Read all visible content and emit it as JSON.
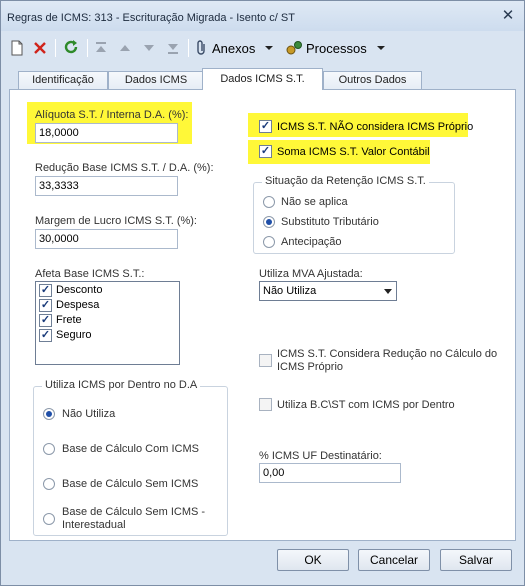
{
  "window": {
    "title": "Regras de ICMS: 313 - Escrituração Migrada - Isento c/ ST",
    "close_glyph": "✕"
  },
  "toolbar": {
    "anexos_label": "Anexos",
    "processos_label": "Processos"
  },
  "tabs": [
    {
      "label": "Identificação"
    },
    {
      "label": "Dados ICMS"
    },
    {
      "label": "Dados ICMS S.T."
    },
    {
      "label": "Outros Dados"
    }
  ],
  "form": {
    "aliquota": {
      "label": "Alíquota S.T. / Interna D.A. (%):",
      "value": "18,0000"
    },
    "reducao": {
      "label": "Redução Base ICMS S.T. / D.A. (%):",
      "value": "33,3333"
    },
    "margem": {
      "label": "Margem de Lucro ICMS S.T. (%):",
      "value": "30,0000"
    },
    "afeta_base": {
      "label": "Afeta Base ICMS S.T.:",
      "items": [
        {
          "label": "Desconto",
          "checked": true
        },
        {
          "label": "Despesa",
          "checked": true
        },
        {
          "label": "Frete",
          "checked": true
        },
        {
          "label": "Seguro",
          "checked": true
        }
      ]
    },
    "utiliza_icms_dentro": {
      "title": "Utiliza ICMS por Dentro no D.A",
      "options": [
        {
          "label": "Não Utiliza",
          "selected": true
        },
        {
          "label": "Base de Cálculo Com ICMS",
          "selected": false
        },
        {
          "label": "Base de Cálculo Sem ICMS",
          "selected": false
        },
        {
          "label": "Base de Cálculo Sem ICMS -",
          "label2": "Interestadual",
          "selected": false
        }
      ]
    },
    "nao_considera": {
      "label": "ICMS S.T. NÃO considera ICMS Próprio",
      "checked": true
    },
    "soma_valor": {
      "label": "Soma ICMS S.T. Valor Contábil",
      "checked": true
    },
    "situacao_retencao": {
      "title": "Situação da Retenção ICMS S.T.",
      "options": [
        {
          "label": "Não se aplica",
          "selected": false
        },
        {
          "label": "Substituto Tributário",
          "selected": true
        },
        {
          "label": "Antecipação",
          "selected": false
        }
      ]
    },
    "mva": {
      "label": "Utiliza MVA Ajustada:",
      "value": "Não Utiliza"
    },
    "considera_reducao": {
      "label": "ICMS S.T. Considera Redução no Cálculo do",
      "label2": "ICMS Próprio",
      "checked": false
    },
    "utiliza_bc": {
      "label": "Utiliza B.C\\ST com ICMS por Dentro",
      "checked": false
    },
    "uf_destinatario": {
      "label": "% ICMS UF Destinatário:",
      "value": "0,00"
    }
  },
  "buttons": {
    "ok": "OK",
    "cancel": "Cancelar",
    "save": "Salvar"
  },
  "check_glyph": "✓"
}
